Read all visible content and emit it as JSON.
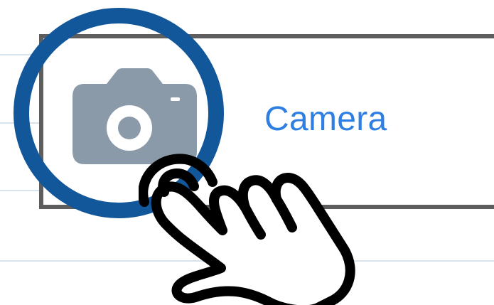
{
  "settings_row": {
    "label": "Camera",
    "label_color": "#2f7fe2",
    "icon": "camera-icon",
    "icon_color": "#8b9aa9"
  },
  "annotation": {
    "highlight_ring_color": "#12579a",
    "pointer_icon": "tap-hand-icon",
    "frame_color": "#5e5e5e"
  },
  "separator_color": "#d9e3ec"
}
